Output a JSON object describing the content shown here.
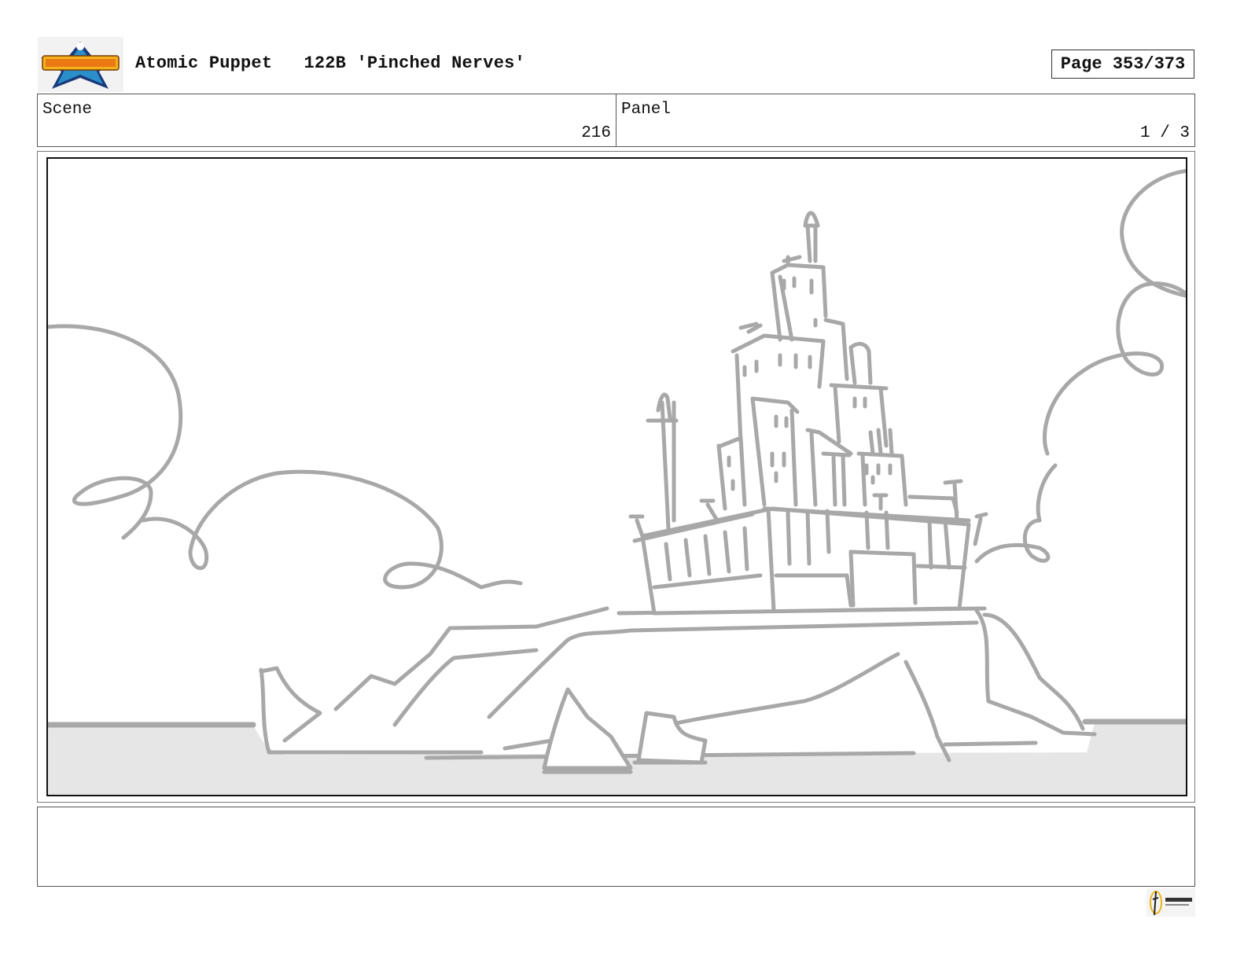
{
  "header": {
    "logo_icon": "atomic-puppet-logo-icon",
    "show_title": "Atomic Puppet",
    "episode": "122B 'Pinched Nerves'",
    "page_label": "Page 353/373"
  },
  "info": {
    "scene_label": "Scene",
    "scene_value": "216",
    "panel_label": "Panel",
    "panel_value": "1 / 3"
  },
  "panel": {
    "image_description_icon": "storyboard-sketch-island-city",
    "sketch_color": "#a8a8a8",
    "water_color": "#e6e6e6"
  },
  "notes": {
    "text": ""
  },
  "footer": {
    "logo_icon": "mercury-filmworks-logo-icon"
  }
}
